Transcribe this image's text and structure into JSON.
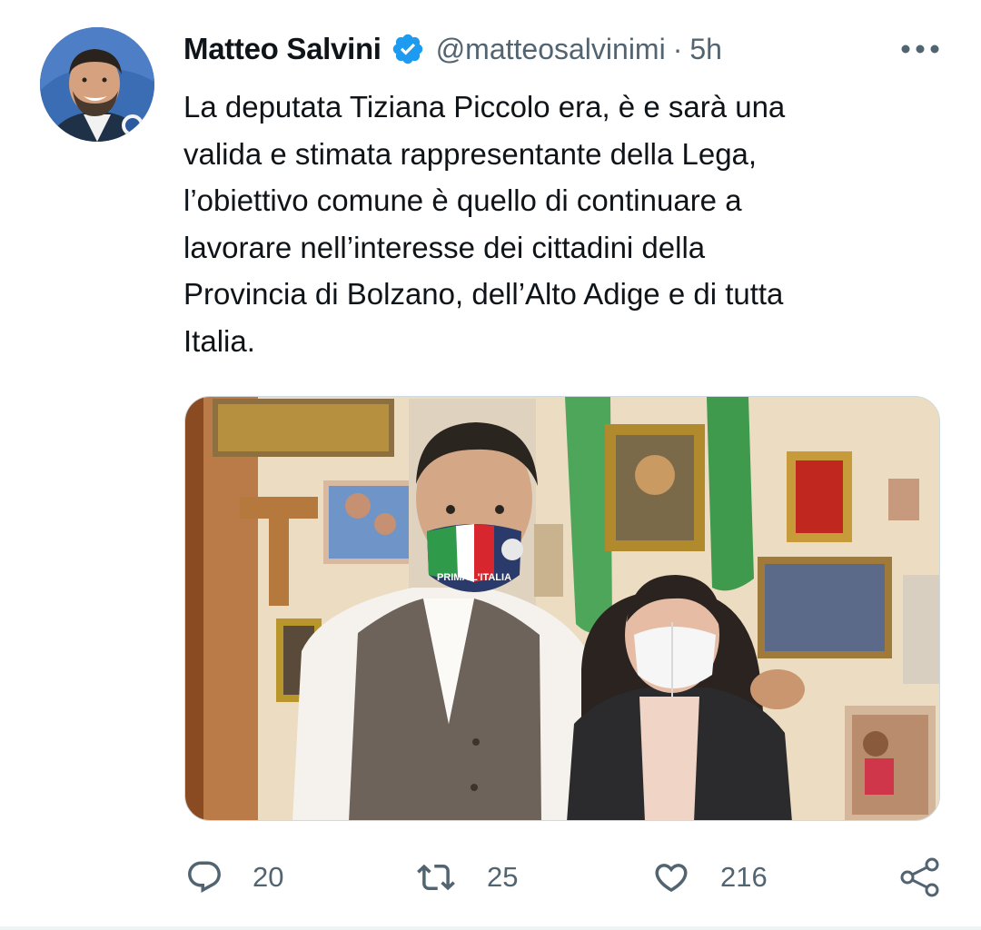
{
  "tweet": {
    "display_name": "Matteo Salvini",
    "handle": "@matteosalvinimi",
    "separator": "·",
    "timestamp": "5h",
    "verified": true,
    "text": "La deputata Tiziana Piccolo era, è e sarà una\nvalida e stimata rappresentante della Lega,\nl’obiettivo comune è quello di continuare a\nlavorare nell’interesse dei cittadini della\nProvincia di Bolzano, dell’Alto Adige e di tutta\nItalia.",
    "media": {
      "type": "photo",
      "mask_text": "PRIMA L'ITALIA"
    }
  },
  "actions": {
    "reply_count": "20",
    "retweet_count": "25",
    "like_count": "216"
  },
  "icons": {
    "verified": "verified-badge-icon",
    "more": "more-horizontal-icon",
    "reply": "reply-icon",
    "retweet": "retweet-icon",
    "like": "heart-icon",
    "share": "share-icon"
  },
  "colors": {
    "text_primary": "#0f1419",
    "text_secondary": "#536471",
    "verified_blue": "#1d9bf0",
    "border": "#cfd9de"
  }
}
